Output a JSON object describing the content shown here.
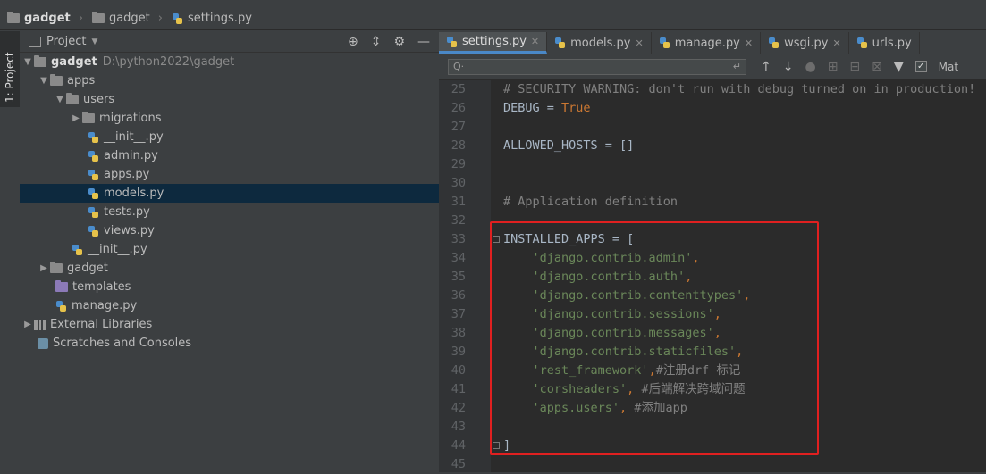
{
  "breadcrumb": {
    "project": "gadget",
    "folder": "gadget",
    "file": "settings.py"
  },
  "sidebar": {
    "tab_label": "1: Project"
  },
  "project_panel": {
    "title": "Project",
    "tree": {
      "root": {
        "name": "gadget",
        "path": "D:\\python2022\\gadget"
      },
      "apps": "apps",
      "users": "users",
      "migrations": "migrations",
      "users_init": "__init__.py",
      "admin": "admin.py",
      "apps_py": "apps.py",
      "models": "models.py",
      "tests": "tests.py",
      "views": "views.py",
      "apps_init": "__init__.py",
      "gadget": "gadget",
      "templates": "templates",
      "manage": "manage.py",
      "external": "External Libraries",
      "scratches": "Scratches and Consoles"
    }
  },
  "editor": {
    "tabs": [
      "settings.py",
      "models.py",
      "manage.py",
      "wsgi.py",
      "urls.py"
    ],
    "search": {
      "placeholder": "Q·",
      "match_case_label": "Mat"
    },
    "lines": [
      {
        "n": "25",
        "t": "# SECURITY WARNING: don't run with debug turned on in production!"
      },
      {
        "n": "26",
        "a": "DEBUG = ",
        "b": "True"
      },
      {
        "n": "27",
        "t": ""
      },
      {
        "n": "28",
        "t": "ALLOWED_HOSTS = []"
      },
      {
        "n": "29",
        "t": ""
      },
      {
        "n": "30",
        "t": ""
      },
      {
        "n": "31",
        "t": "# Application definition"
      },
      {
        "n": "32",
        "t": ""
      },
      {
        "n": "33",
        "t": "INSTALLED_APPS = ["
      },
      {
        "n": "34",
        "s": "    'django.contrib.admin'",
        "e": ","
      },
      {
        "n": "35",
        "s": "    'django.contrib.auth'",
        "e": ","
      },
      {
        "n": "36",
        "s": "    'django.contrib.contenttypes'",
        "e": ","
      },
      {
        "n": "37",
        "s": "    'django.contrib.sessions'",
        "e": ","
      },
      {
        "n": "38",
        "s": "    'django.contrib.messages'",
        "e": ","
      },
      {
        "n": "39",
        "s": "    'django.contrib.staticfiles'",
        "e": ","
      },
      {
        "n": "40",
        "s": "    'rest_framework'",
        "e": ",",
        "c": "#注册drf 标记"
      },
      {
        "n": "41",
        "s": "    'corsheaders'",
        "e": ", ",
        "c": "#后端解决跨域问题"
      },
      {
        "n": "42",
        "s": "    'apps.users'",
        "e": ", ",
        "c": "#添加app"
      },
      {
        "n": "43",
        "t": ""
      },
      {
        "n": "44",
        "t": "]"
      },
      {
        "n": "45",
        "t": ""
      }
    ]
  }
}
